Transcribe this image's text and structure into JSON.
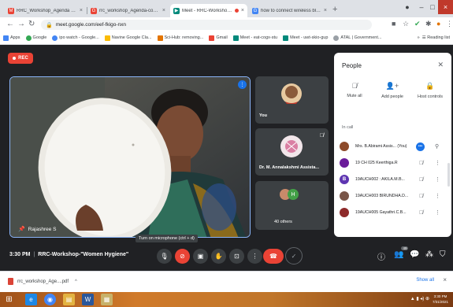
{
  "browser": {
    "tabs": [
      {
        "title": "RRC_Workshop_Agenda - akila",
        "favicon_color": "#ea4335",
        "favicon": "M"
      },
      {
        "title": "rrc_workshop_Agenda-conversio",
        "favicon_color": "#ea4335",
        "favicon": "G"
      },
      {
        "title": "Meet - RRC-Workshop-\"Wo",
        "favicon_color": "#00897b",
        "favicon": "▶"
      },
      {
        "title": "how to connect wireless bluetoo",
        "favicon_color": "#4285f4",
        "favicon": "G"
      }
    ],
    "url": "meet.google.com/eef-fkigo-nxn",
    "bookmarks": [
      {
        "label": "Apps",
        "color": "#4285f4"
      },
      {
        "label": "Google",
        "color": "#34a853"
      },
      {
        "label": "ipo watch - Google...",
        "color": "#4285f4"
      },
      {
        "label": "Navine Google Cla...",
        "color": "#fbbc04"
      },
      {
        "label": "Sci-Hub: removing...",
        "color": "#e37400"
      },
      {
        "label": "Gmail",
        "color": "#ea4335"
      },
      {
        "label": "Meet - eat-cogx-stu",
        "color": "#00897b"
      },
      {
        "label": "Meet - uwt-skio-gup",
        "color": "#00897b"
      },
      {
        "label": "ATAL | Government...",
        "color": "#9aa0a6"
      }
    ],
    "reading_list": "Reading list"
  },
  "meet": {
    "rec_label": "REC",
    "main_participant": "Rajashree S",
    "tiles": [
      {
        "label": "You"
      },
      {
        "label": "Dr. M. Annalakshmi Assista..."
      },
      {
        "label": "40 others",
        "avatar_letter": "H"
      }
    ],
    "tooltip": "Turn on microphone (ctrl + d)",
    "time": "3:30 PM",
    "meeting_name": "RRC-Workshop-\"Women Hygiene\"",
    "activities_badge": "49"
  },
  "people_panel": {
    "title": "People",
    "actions": [
      {
        "label": "Mute all",
        "icon": "mic-off-icon"
      },
      {
        "label": "Add people",
        "icon": "add-person-icon"
      },
      {
        "label": "Host controls",
        "icon": "lock-icon"
      }
    ],
    "section": "In call",
    "participants": [
      {
        "name": "Mrs. B.Abirami Assis... (You)",
        "avatar_color": "#8d4a2a",
        "avatar": ""
      },
      {
        "name": "19 CH 025 Keerthiga.R",
        "avatar_color": "#6a1b9a",
        "avatar": ""
      },
      {
        "name": "19AUCH002 : AKILA.M.B...",
        "avatar_color": "#5e35b1",
        "avatar": "B"
      },
      {
        "name": "19AUCH003 BIRUNDHA.D...",
        "avatar_color": "#795548",
        "avatar": ""
      },
      {
        "name": "19AUCH005 Gayathri.C.B...",
        "avatar_color": "#8e2a2a",
        "avatar": ""
      }
    ]
  },
  "downloads": {
    "file": "rrc_workshop_Age....pdf",
    "show_all": "Show all"
  },
  "taskbar": {
    "time": "3:30 PM",
    "date": "7/31/2021"
  }
}
